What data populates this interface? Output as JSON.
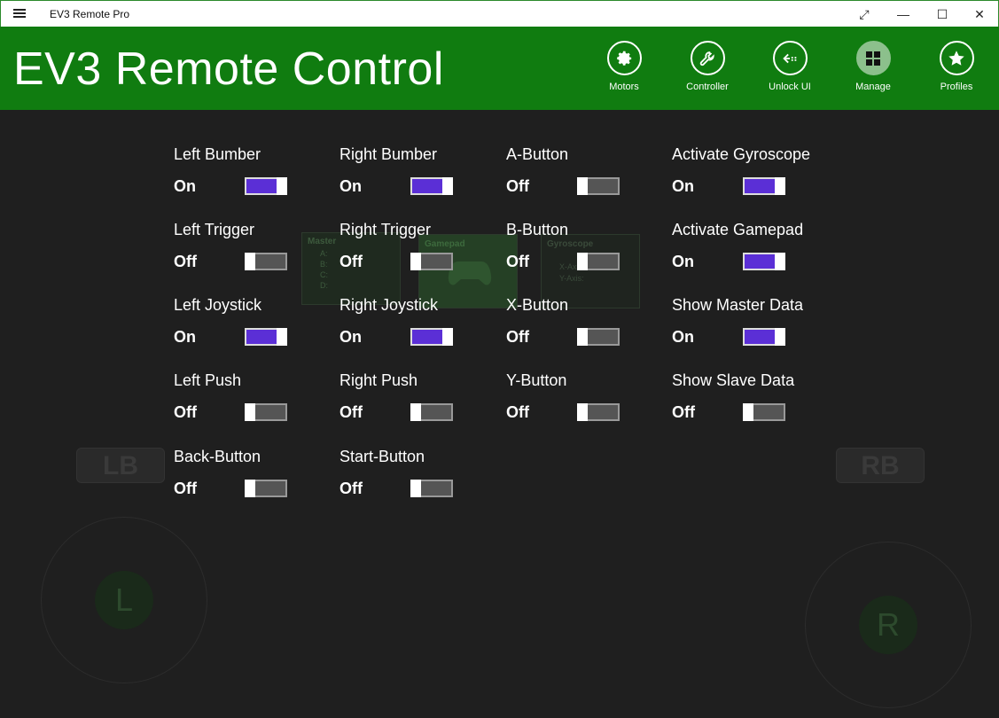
{
  "window": {
    "title": "EV3 Remote Pro",
    "controls": {
      "fullscreen": "⤢",
      "minimize": "—",
      "maximize": "☐",
      "close": "✕"
    }
  },
  "header": {
    "title": "EV3 Remote Control",
    "nav": [
      {
        "label": "Motors",
        "icon": "gear-icon"
      },
      {
        "label": "Controller",
        "icon": "wrench-icon"
      },
      {
        "label": "Unlock UI",
        "icon": "unlock-ui-icon"
      },
      {
        "label": "Manage",
        "icon": "grid-icon",
        "active": true
      },
      {
        "label": "Profiles",
        "icon": "star-icon"
      }
    ]
  },
  "background": {
    "master_title": "Master",
    "master_rows": [
      "A:",
      "B:",
      "C:",
      "D:"
    ],
    "gamepad_title": "Gamepad",
    "gyro_title": "Gyroscope",
    "gyro_rows": [
      "X-Axis:",
      "Y-Axis:"
    ],
    "lb": "LB",
    "rb": "RB",
    "left_stick": "L",
    "right_stick": "R"
  },
  "settings": [
    {
      "name": "Left Bumber",
      "state": "On",
      "on": true
    },
    {
      "name": "Left Trigger",
      "state": "Off",
      "on": false
    },
    {
      "name": "Left Joystick",
      "state": "On",
      "on": true
    },
    {
      "name": "Left Push",
      "state": "Off",
      "on": false
    },
    {
      "name": "Back-Button",
      "state": "Off",
      "on": false
    },
    {
      "name": "Right Bumber",
      "state": "On",
      "on": true
    },
    {
      "name": "Right Trigger",
      "state": "Off",
      "on": false
    },
    {
      "name": "Right Joystick",
      "state": "On",
      "on": true
    },
    {
      "name": "Right Push",
      "state": "Off",
      "on": false
    },
    {
      "name": "Start-Button",
      "state": "Off",
      "on": false
    },
    {
      "name": "A-Button",
      "state": "Off",
      "on": false
    },
    {
      "name": "B-Button",
      "state": "Off",
      "on": false
    },
    {
      "name": "X-Button",
      "state": "Off",
      "on": false
    },
    {
      "name": "Y-Button",
      "state": "Off",
      "on": false
    },
    {
      "name": "Activate Gyroscope",
      "state": "On",
      "on": true
    },
    {
      "name": "Activate Gamepad",
      "state": "On",
      "on": true
    },
    {
      "name": "Show Master Data",
      "state": "On",
      "on": true
    },
    {
      "name": "Show Slave Data",
      "state": "Off",
      "on": false
    }
  ],
  "colors": {
    "header_green": "#107c10",
    "toggle_on": "#5b2fd6",
    "background": "#1f1f1f"
  }
}
